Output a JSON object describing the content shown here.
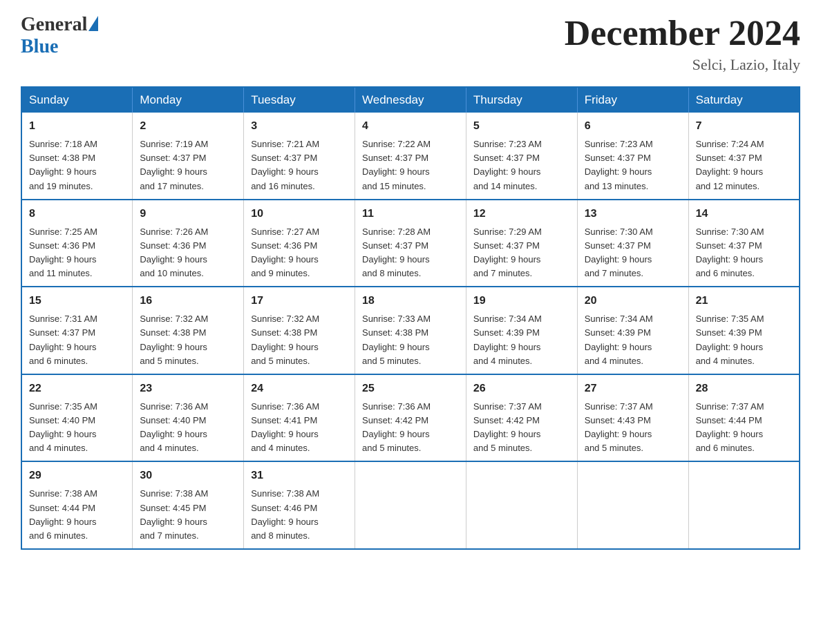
{
  "logo": {
    "general": "General",
    "blue": "Blue",
    "triangle": "▲"
  },
  "title": "December 2024",
  "subtitle": "Selci, Lazio, Italy",
  "days_of_week": [
    "Sunday",
    "Monday",
    "Tuesday",
    "Wednesday",
    "Thursday",
    "Friday",
    "Saturday"
  ],
  "weeks": [
    [
      {
        "day": "1",
        "sunrise": "7:18 AM",
        "sunset": "4:38 PM",
        "daylight": "9 hours and 19 minutes."
      },
      {
        "day": "2",
        "sunrise": "7:19 AM",
        "sunset": "4:37 PM",
        "daylight": "9 hours and 17 minutes."
      },
      {
        "day": "3",
        "sunrise": "7:21 AM",
        "sunset": "4:37 PM",
        "daylight": "9 hours and 16 minutes."
      },
      {
        "day": "4",
        "sunrise": "7:22 AM",
        "sunset": "4:37 PM",
        "daylight": "9 hours and 15 minutes."
      },
      {
        "day": "5",
        "sunrise": "7:23 AM",
        "sunset": "4:37 PM",
        "daylight": "9 hours and 14 minutes."
      },
      {
        "day": "6",
        "sunrise": "7:23 AM",
        "sunset": "4:37 PM",
        "daylight": "9 hours and 13 minutes."
      },
      {
        "day": "7",
        "sunrise": "7:24 AM",
        "sunset": "4:37 PM",
        "daylight": "9 hours and 12 minutes."
      }
    ],
    [
      {
        "day": "8",
        "sunrise": "7:25 AM",
        "sunset": "4:36 PM",
        "daylight": "9 hours and 11 minutes."
      },
      {
        "day": "9",
        "sunrise": "7:26 AM",
        "sunset": "4:36 PM",
        "daylight": "9 hours and 10 minutes."
      },
      {
        "day": "10",
        "sunrise": "7:27 AM",
        "sunset": "4:36 PM",
        "daylight": "9 hours and 9 minutes."
      },
      {
        "day": "11",
        "sunrise": "7:28 AM",
        "sunset": "4:37 PM",
        "daylight": "9 hours and 8 minutes."
      },
      {
        "day": "12",
        "sunrise": "7:29 AM",
        "sunset": "4:37 PM",
        "daylight": "9 hours and 7 minutes."
      },
      {
        "day": "13",
        "sunrise": "7:30 AM",
        "sunset": "4:37 PM",
        "daylight": "9 hours and 7 minutes."
      },
      {
        "day": "14",
        "sunrise": "7:30 AM",
        "sunset": "4:37 PM",
        "daylight": "9 hours and 6 minutes."
      }
    ],
    [
      {
        "day": "15",
        "sunrise": "7:31 AM",
        "sunset": "4:37 PM",
        "daylight": "9 hours and 6 minutes."
      },
      {
        "day": "16",
        "sunrise": "7:32 AM",
        "sunset": "4:38 PM",
        "daylight": "9 hours and 5 minutes."
      },
      {
        "day": "17",
        "sunrise": "7:32 AM",
        "sunset": "4:38 PM",
        "daylight": "9 hours and 5 minutes."
      },
      {
        "day": "18",
        "sunrise": "7:33 AM",
        "sunset": "4:38 PM",
        "daylight": "9 hours and 5 minutes."
      },
      {
        "day": "19",
        "sunrise": "7:34 AM",
        "sunset": "4:39 PM",
        "daylight": "9 hours and 4 minutes."
      },
      {
        "day": "20",
        "sunrise": "7:34 AM",
        "sunset": "4:39 PM",
        "daylight": "9 hours and 4 minutes."
      },
      {
        "day": "21",
        "sunrise": "7:35 AM",
        "sunset": "4:39 PM",
        "daylight": "9 hours and 4 minutes."
      }
    ],
    [
      {
        "day": "22",
        "sunrise": "7:35 AM",
        "sunset": "4:40 PM",
        "daylight": "9 hours and 4 minutes."
      },
      {
        "day": "23",
        "sunrise": "7:36 AM",
        "sunset": "4:40 PM",
        "daylight": "9 hours and 4 minutes."
      },
      {
        "day": "24",
        "sunrise": "7:36 AM",
        "sunset": "4:41 PM",
        "daylight": "9 hours and 4 minutes."
      },
      {
        "day": "25",
        "sunrise": "7:36 AM",
        "sunset": "4:42 PM",
        "daylight": "9 hours and 5 minutes."
      },
      {
        "day": "26",
        "sunrise": "7:37 AM",
        "sunset": "4:42 PM",
        "daylight": "9 hours and 5 minutes."
      },
      {
        "day": "27",
        "sunrise": "7:37 AM",
        "sunset": "4:43 PM",
        "daylight": "9 hours and 5 minutes."
      },
      {
        "day": "28",
        "sunrise": "7:37 AM",
        "sunset": "4:44 PM",
        "daylight": "9 hours and 6 minutes."
      }
    ],
    [
      {
        "day": "29",
        "sunrise": "7:38 AM",
        "sunset": "4:44 PM",
        "daylight": "9 hours and 6 minutes."
      },
      {
        "day": "30",
        "sunrise": "7:38 AM",
        "sunset": "4:45 PM",
        "daylight": "9 hours and 7 minutes."
      },
      {
        "day": "31",
        "sunrise": "7:38 AM",
        "sunset": "4:46 PM",
        "daylight": "9 hours and 8 minutes."
      },
      null,
      null,
      null,
      null
    ]
  ],
  "labels": {
    "sunrise": "Sunrise:",
    "sunset": "Sunset:",
    "daylight": "Daylight:"
  }
}
